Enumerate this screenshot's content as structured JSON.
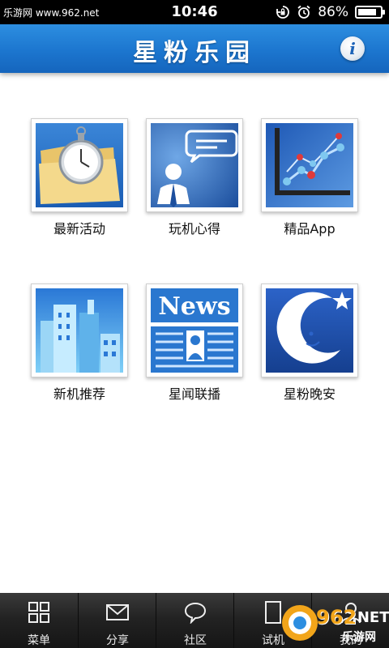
{
  "status_bar": {
    "carrier": "乐游网 www.962.net",
    "time": "10:46",
    "battery_percent_text": "86%",
    "battery_level": 0.86,
    "icons": [
      "rotation-lock-icon",
      "alarm-icon",
      "battery-icon"
    ]
  },
  "header": {
    "title": "星粉乐园",
    "info_icon": "info-icon",
    "info_glyph": "i"
  },
  "grid": {
    "items": [
      {
        "label": "最新活动",
        "icon": "stopwatch-folder-icon"
      },
      {
        "label": "玩机心得",
        "icon": "speech-person-icon"
      },
      {
        "label": "精品App",
        "icon": "line-chart-icon"
      },
      {
        "label": "新机推荐",
        "icon": "city-buildings-icon"
      },
      {
        "label": "星闻联播",
        "icon": "news-icon",
        "icon_text": "News"
      },
      {
        "label": "星粉晚安",
        "icon": "moon-star-icon"
      }
    ]
  },
  "tab_bar": {
    "items": [
      {
        "label": "菜单",
        "icon": "grid-menu-icon"
      },
      {
        "label": "分享",
        "icon": "envelope-icon"
      },
      {
        "label": "社区",
        "icon": "chat-bubble-icon"
      },
      {
        "label": "试机",
        "icon": "phone-icon"
      },
      {
        "label": "我的",
        "icon": "user-icon"
      }
    ]
  },
  "watermark": {
    "brand": "962",
    "suffix": ".NET",
    "subtitle": "乐游网"
  },
  "colors": {
    "header_blue": "#1c76cf",
    "tab_bar_dark": "#232323",
    "tile_blue": "#1f66c4"
  }
}
